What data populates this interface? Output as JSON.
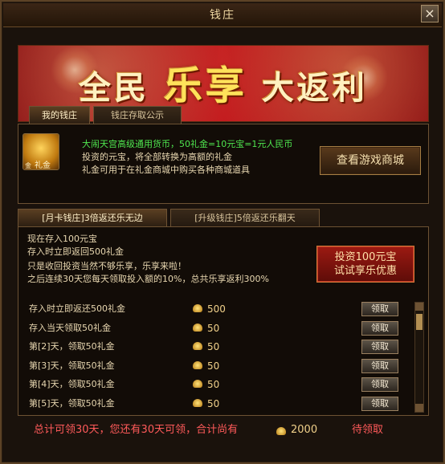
{
  "window": {
    "title": "钱庄",
    "close_label": "×"
  },
  "banner": {
    "left": "全民",
    "mid": "乐享",
    "right": "大返利"
  },
  "top_tabs": [
    "我的钱庄",
    "钱庄存取公示"
  ],
  "exchange": {
    "icon_label": "礼金",
    "icon_sub": "金",
    "line1": "大闹天宫高级通用货币，50礼金=10元宝=1元人民币",
    "line2": "投资的元宝，将全部转换为高额的礼金",
    "line3": "礼金可用于在礼金商城中购买各种商城道具",
    "shop_button": "查看游戏商城"
  },
  "sub_tabs": [
    "[月卡钱庄]3倍返还乐无边",
    "[升级钱庄]5倍返还乐翻天"
  ],
  "invest": {
    "line1": "现在存入100元宝",
    "line2": "存入时立即返回500礼金",
    "line3": "只是收回投资当然不够乐享，乐享来啦！",
    "line4": "之后连续30天您每天领取投入额的10%，总共乐享返利300%",
    "button_line1": "投资100元宝",
    "button_line2": "试试享乐优惠"
  },
  "rewards": [
    {
      "name": "存入时立即返还500礼金",
      "amount": "500",
      "claim": "领取"
    },
    {
      "name": "存入当天领取50礼金",
      "amount": "50",
      "claim": "领取"
    },
    {
      "name": "第[2]天，领取50礼金",
      "amount": "50",
      "claim": "领取"
    },
    {
      "name": "第[3]天，领取50礼金",
      "amount": "50",
      "claim": "领取"
    },
    {
      "name": "第[4]天，领取50礼金",
      "amount": "50",
      "claim": "领取"
    },
    {
      "name": "第[5]天，领取50礼金",
      "amount": "50",
      "claim": "领取"
    }
  ],
  "footer": {
    "text": "总计可领30天，您还有30天可领，合计尚有",
    "total": "2000",
    "status": "待领取"
  }
}
